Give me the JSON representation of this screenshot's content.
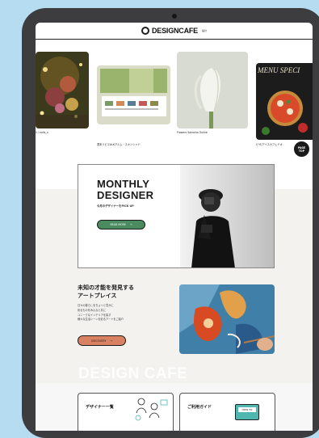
{
  "header": {
    "logo_text": "DESIGNCAFE",
    "logo_sub": "設計"
  },
  "gallery": [
    {
      "caption": "ii / nails_n"
    },
    {
      "caption": "週末リビエALKアルム・スキンシャド"
    },
    {
      "caption": "Flowers Sakusha Online"
    },
    {
      "caption": "ピザ/アイスカフェドオ"
    }
  ],
  "menu_card": {
    "text": "MENU SPECI"
  },
  "page_top": {
    "line1": "PAGE",
    "line2": "TOP"
  },
  "monthly": {
    "title_line1": "MONTHLY",
    "title_line2": "DESIGNER",
    "subtitle": "今月のデザイナーをPICK UP",
    "button_label": "READ MORE",
    "button_arrow": "→"
  },
  "art": {
    "title_line1": "未知の才能を発見する",
    "title_line2": "アートプレイス",
    "body": [
      "日々の暮らしをちょっと豊かに",
      "彩るものをみんなと共に",
      "ユニークなインテリアを探す",
      "様々な生活シーンを彩るアートをご紹介"
    ],
    "button_label": "DISCOVERY",
    "button_arrow": "→"
  },
  "watermark": "DESIGN CAFE",
  "bottom_cards": [
    {
      "label": "デザイナー一覧"
    },
    {
      "label": "ご利用ガイド",
      "badge": "HOW TO"
    }
  ],
  "colors": {
    "background": "#b6dcf1",
    "tablet": "#3d3d3f",
    "monthly_button": "#4a8c60",
    "discovery_button": "#d98163",
    "howto": "#4fb7b0"
  }
}
